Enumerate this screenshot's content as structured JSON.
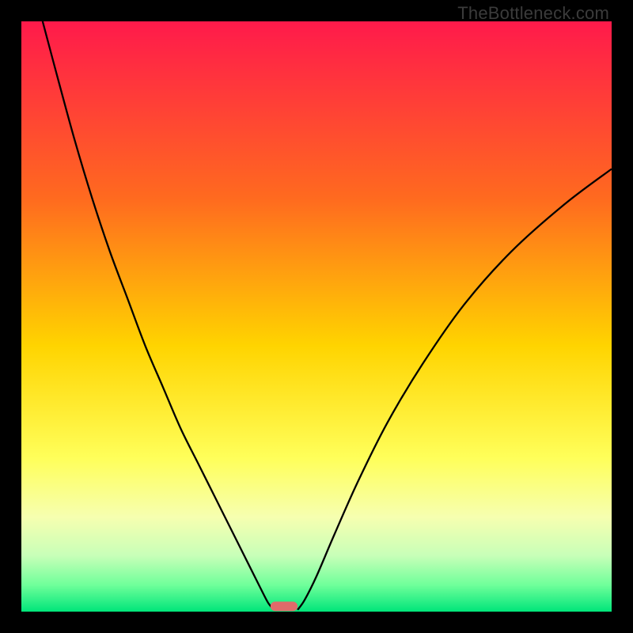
{
  "watermark": "TheBottleneck.com",
  "chart_data": {
    "type": "line",
    "title": "",
    "xlabel": "",
    "ylabel": "",
    "xlim": [
      0,
      100
    ],
    "ylim": [
      0,
      100
    ],
    "gradient_stops": [
      {
        "offset": 0,
        "color": "#ff1a4b"
      },
      {
        "offset": 0.3,
        "color": "#ff6a1f"
      },
      {
        "offset": 0.55,
        "color": "#ffd400"
      },
      {
        "offset": 0.74,
        "color": "#ffff5a"
      },
      {
        "offset": 0.84,
        "color": "#f6ffb0"
      },
      {
        "offset": 0.905,
        "color": "#c8ffb8"
      },
      {
        "offset": 0.955,
        "color": "#6fff9a"
      },
      {
        "offset": 1.0,
        "color": "#00e57a"
      }
    ],
    "series": [
      {
        "name": "left-branch",
        "x": [
          3.6,
          6,
          9,
          12,
          15,
          18,
          21,
          24,
          27,
          30,
          33,
          36,
          38.5,
          40.5,
          41.8,
          42.8
        ],
        "y": [
          100,
          91,
          80,
          70,
          61,
          53,
          45,
          38,
          31,
          25,
          19,
          13,
          8,
          4,
          1.5,
          0.3
        ]
      },
      {
        "name": "right-branch",
        "x": [
          46.8,
          48,
          50,
          53,
          57,
          62,
          68,
          75,
          83,
          92,
          100
        ],
        "y": [
          0.3,
          2,
          6,
          13,
          22,
          32,
          42,
          52,
          61,
          69,
          75
        ]
      }
    ],
    "marker": {
      "name": "min-marker",
      "x_center": 44.5,
      "y": 0.1,
      "width": 4.6,
      "height": 1.6,
      "rx": 0.8,
      "color": "#e06a6a"
    }
  }
}
